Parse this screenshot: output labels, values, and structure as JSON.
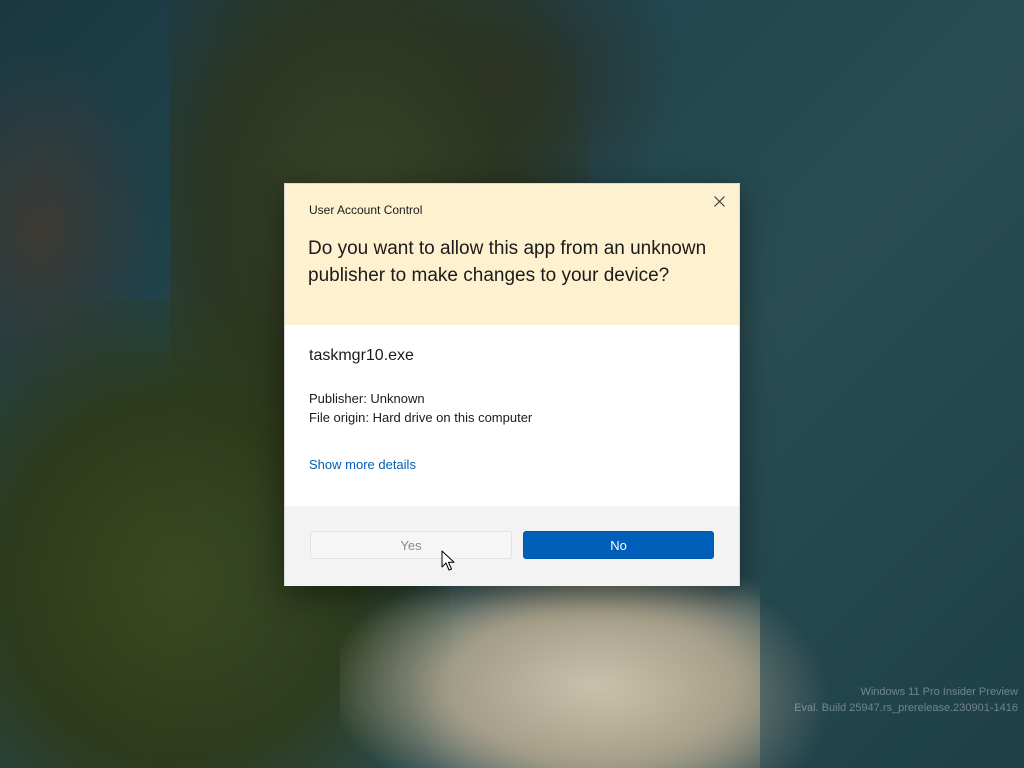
{
  "desktop": {
    "watermark_line1": "Windows 11 Pro Insider Preview",
    "watermark_line2": "Eval. Build 25947.rs_prerelease.230901-1416"
  },
  "dialog": {
    "title": "User Account Control",
    "question": "Do you want to allow this app from an unknown publisher to make changes to your device?",
    "app_name": "taskmgr10.exe",
    "publisher": "Publisher: Unknown",
    "file_origin": "File origin: Hard drive on this computer",
    "details_link": "Show more details",
    "yes_label": "Yes",
    "no_label": "No",
    "close_icon": "close-icon"
  },
  "colors": {
    "header_bg": "#fdf1cf",
    "accent": "#005fb8",
    "footer_bg": "#f3f3f3"
  }
}
